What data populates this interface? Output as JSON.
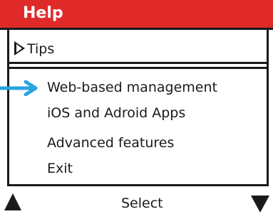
{
  "header": {
    "title": "Help"
  },
  "menu": {
    "tips_label": "Tips",
    "items": [
      {
        "label": "Web-based management"
      },
      {
        "label": "iOS and Adroid Apps"
      },
      {
        "label": "Advanced features"
      },
      {
        "label": "Exit"
      }
    ]
  },
  "footer": {
    "select_label": "Select"
  },
  "colors": {
    "title_bar": "#e02a2a",
    "pointer_arrow": "#2aa3e0",
    "text": "#1a1a1a"
  },
  "icons": {
    "tips": "play-outline-icon",
    "pointer": "arrow-right-icon",
    "up": "triangle-up-icon",
    "down": "triangle-down-icon"
  }
}
